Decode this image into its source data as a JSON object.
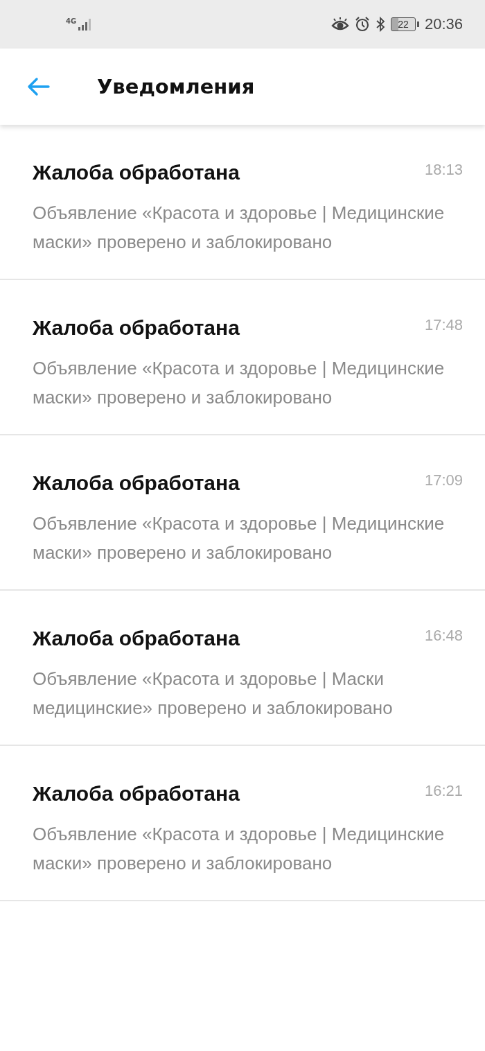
{
  "status_bar": {
    "network": "4G",
    "battery": "22",
    "time": "20:36"
  },
  "header": {
    "title": "Уведомления"
  },
  "notifications": [
    {
      "title": "Жалоба обработана",
      "time": "18:13",
      "text": "Объявление «Красота и здоровье | Медицинские маски» проверено и заблокировано"
    },
    {
      "title": "Жалоба обработана",
      "time": "17:48",
      "text": "Объявление «Красота и здоровье | Медицинские маски» проверено и заблокировано"
    },
    {
      "title": "Жалоба обработана",
      "time": "17:09",
      "text": "Объявление «Красота и здоровье | Медицинские маски» проверено и заблокировано"
    },
    {
      "title": "Жалоба обработана",
      "time": "16:48",
      "text": "Объявление «Красота и здоровье | Маски медицинские» проверено и заблокировано"
    },
    {
      "title": "Жалоба обработана",
      "time": "16:21",
      "text": "Объявление «Красота и здоровье | Медицинские маски» проверено и заблокировано"
    }
  ]
}
